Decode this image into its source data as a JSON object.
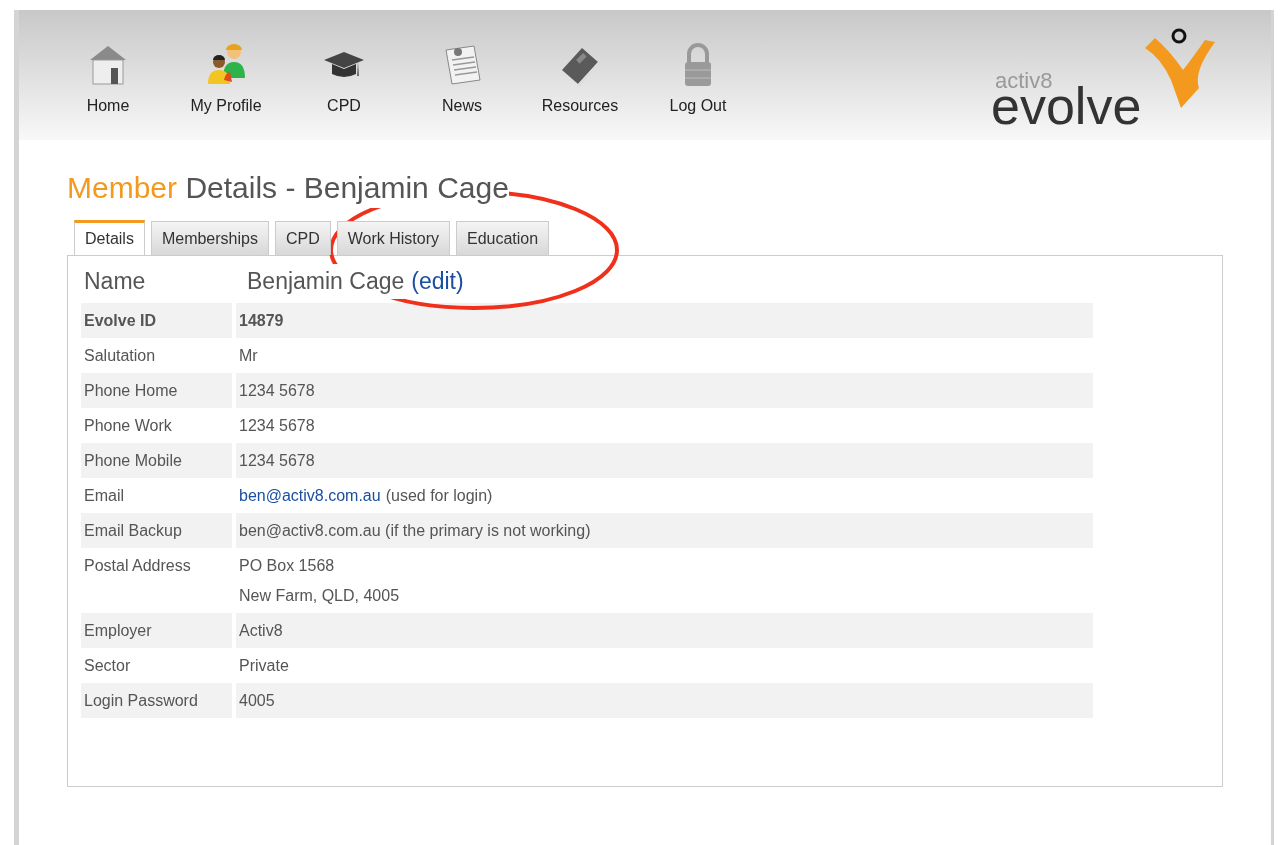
{
  "nav": [
    {
      "label": "Home",
      "kind": "house"
    },
    {
      "label": "My Profile",
      "kind": "people"
    },
    {
      "label": "CPD",
      "kind": "cap"
    },
    {
      "label": "News",
      "kind": "news"
    },
    {
      "label": "Resources",
      "kind": "book"
    },
    {
      "label": "Log Out",
      "kind": "lock"
    }
  ],
  "logo": {
    "small": "activ8",
    "big": "evolve"
  },
  "title": {
    "highlight": "Member",
    "rest": "Details - Benjamin Cage"
  },
  "tabs": [
    {
      "label": "Details",
      "selected": true
    },
    {
      "label": "Memberships",
      "selected": false
    },
    {
      "label": "CPD",
      "selected": false
    },
    {
      "label": "Work History",
      "selected": false
    },
    {
      "label": "Education",
      "selected": false
    }
  ],
  "name_row": {
    "label": "Name",
    "value": "Benjamin Cage",
    "link": "(edit)"
  },
  "rows": [
    {
      "kind": "bold",
      "label": "Evolve ID",
      "lines": [
        "14879"
      ]
    },
    {
      "kind": "plain",
      "label": "Salutation",
      "lines": [
        "Mr"
      ]
    },
    {
      "kind": "plain",
      "label": "Phone Home",
      "lines": [
        "1234 5678"
      ]
    },
    {
      "kind": "plain",
      "label": "Phone Work",
      "lines": [
        "1234 5678"
      ]
    },
    {
      "kind": "plain",
      "label": "Phone Mobile",
      "lines": [
        "1234 5678"
      ]
    },
    {
      "kind": "link",
      "label": "Email",
      "link": "ben@activ8.com.au",
      "lines": [
        "(used for login)"
      ]
    },
    {
      "kind": "plain",
      "label": "Email Backup",
      "lines": [
        "ben@activ8.com.au (if the primary is not working)"
      ]
    },
    {
      "kind": "plain",
      "label": "Postal Address",
      "lines": [
        "PO Box 1568",
        "New Farm, QLD, 4005"
      ]
    },
    {
      "kind": "plain",
      "label": "Employer",
      "lines": [
        "Activ8"
      ]
    },
    {
      "kind": "plain",
      "label": "Sector",
      "lines": [
        "Private"
      ]
    },
    {
      "kind": "plain",
      "label": "Login Password",
      "lines": [
        "4005"
      ]
    }
  ],
  "annotation": {
    "kind": "ellipse"
  }
}
